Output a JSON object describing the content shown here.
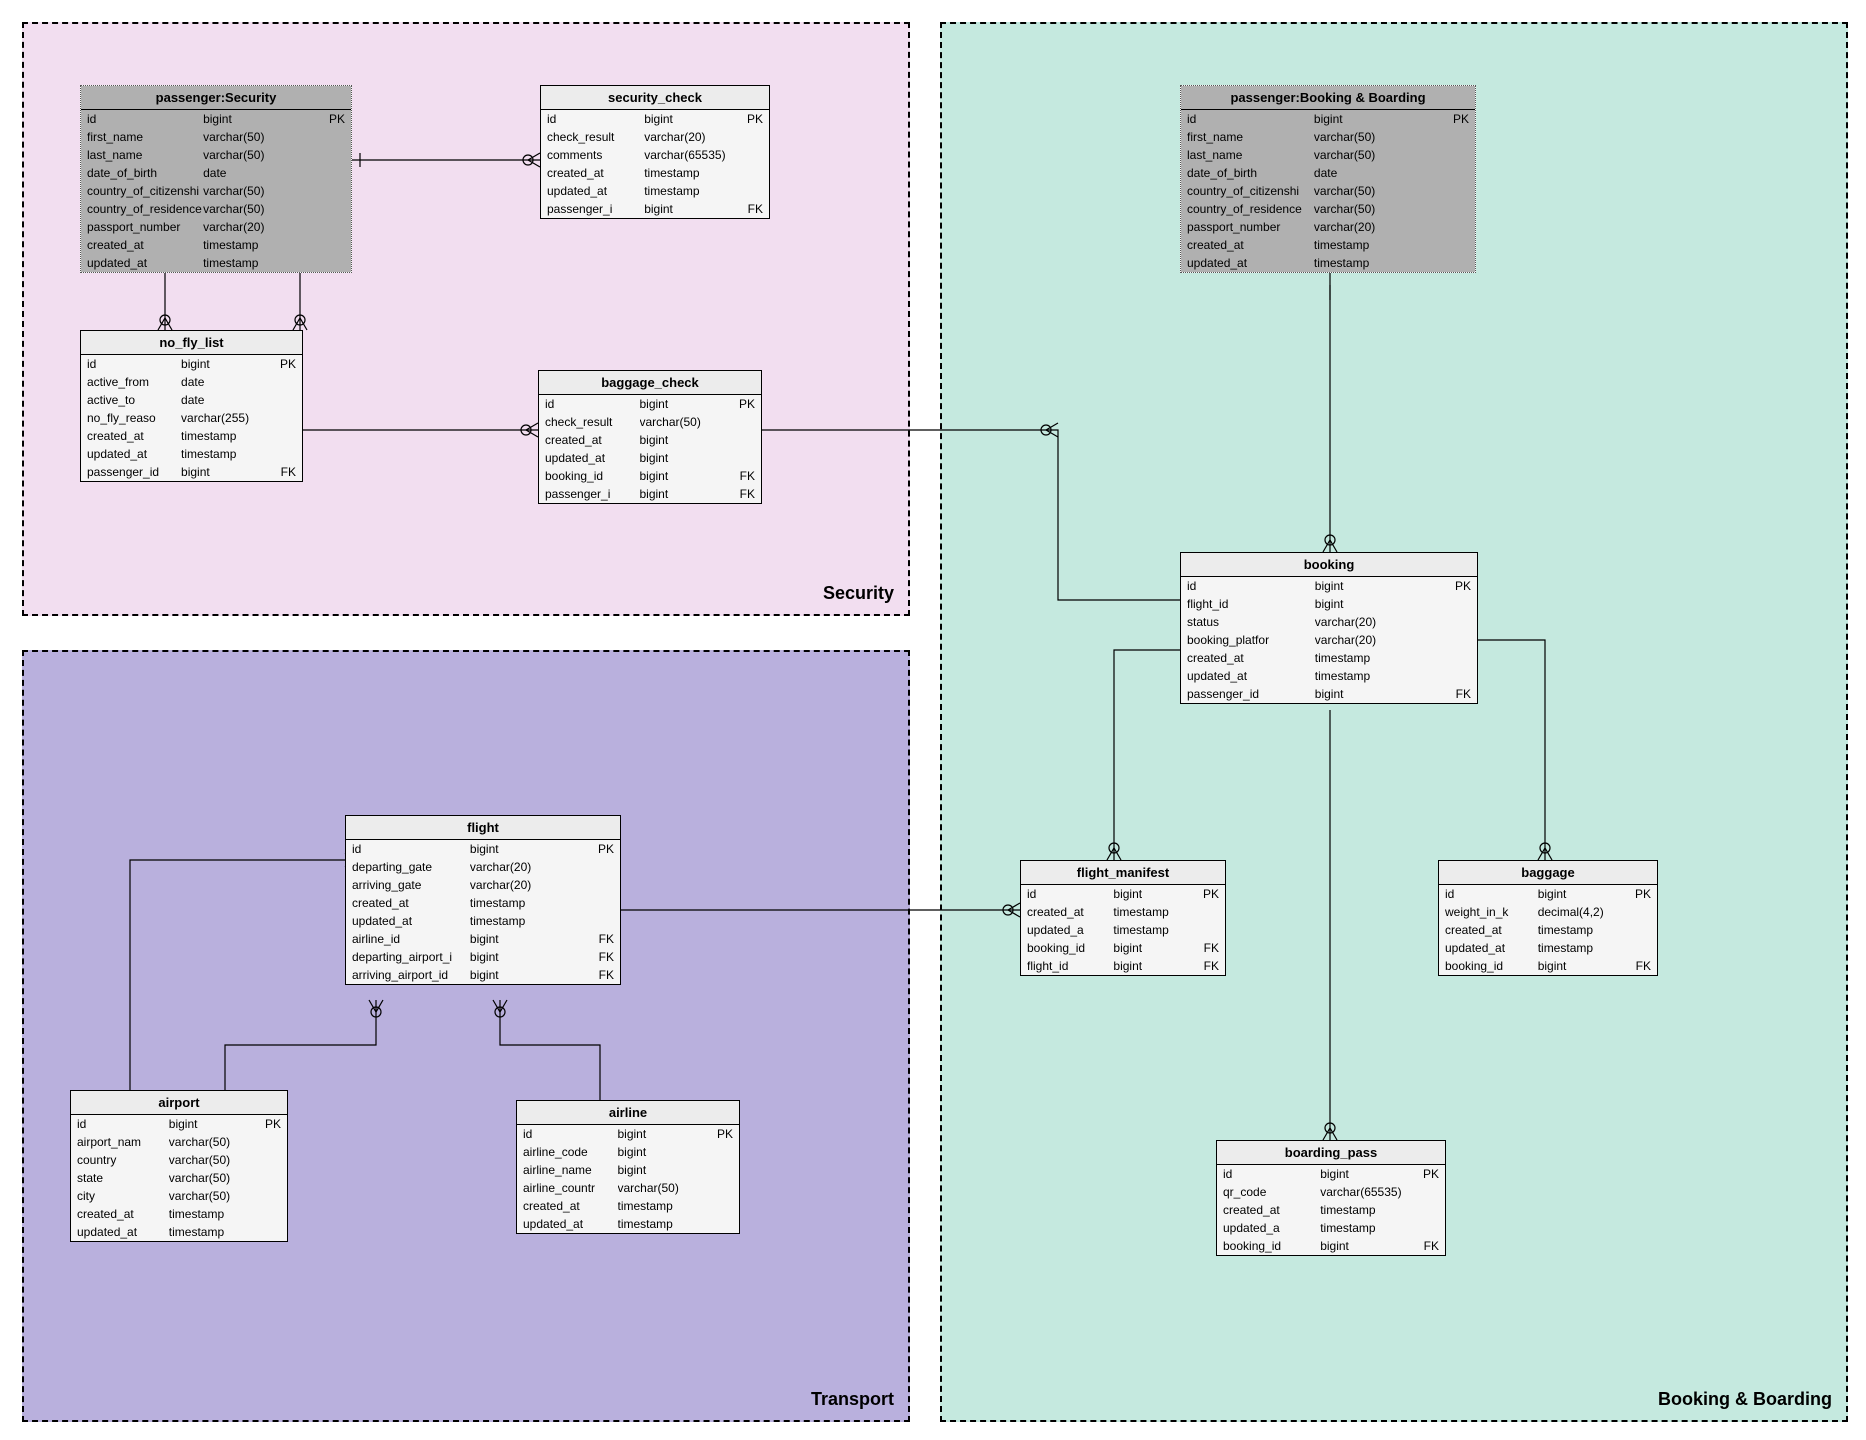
{
  "regions": {
    "security": {
      "label": "Security"
    },
    "transport": {
      "label": "Transport"
    },
    "booking": {
      "label": "Booking & Boarding"
    }
  },
  "tables": {
    "passenger_security": {
      "title": "passenger:Security",
      "rows": [
        {
          "name": "id",
          "type": "bigint",
          "key": "PK"
        },
        {
          "name": "first_name",
          "type": "varchar(50)",
          "key": ""
        },
        {
          "name": "last_name",
          "type": "varchar(50)",
          "key": ""
        },
        {
          "name": "date_of_birth",
          "type": "date",
          "key": ""
        },
        {
          "name": "country_of_citizenshi",
          "type": "varchar(50)",
          "key": ""
        },
        {
          "name": "country_of_residence",
          "type": "varchar(50)",
          "key": ""
        },
        {
          "name": "passport_number",
          "type": "varchar(20)",
          "key": ""
        },
        {
          "name": "created_at",
          "type": "timestamp",
          "key": ""
        },
        {
          "name": "updated_at",
          "type": "timestamp",
          "key": ""
        }
      ]
    },
    "security_check": {
      "title": "security_check",
      "rows": [
        {
          "name": "id",
          "type": "bigint",
          "key": "PK"
        },
        {
          "name": "check_result",
          "type": "varchar(20)",
          "key": ""
        },
        {
          "name": "comments",
          "type": "varchar(65535)",
          "key": ""
        },
        {
          "name": "created_at",
          "type": "timestamp",
          "key": ""
        },
        {
          "name": "updated_at",
          "type": "timestamp",
          "key": ""
        },
        {
          "name": "passenger_i",
          "type": "bigint",
          "key": "FK"
        }
      ]
    },
    "no_fly_list": {
      "title": "no_fly_list",
      "rows": [
        {
          "name": "id",
          "type": "bigint",
          "key": "PK"
        },
        {
          "name": "active_from",
          "type": "date",
          "key": ""
        },
        {
          "name": "active_to",
          "type": "date",
          "key": ""
        },
        {
          "name": "no_fly_reaso",
          "type": "varchar(255)",
          "key": ""
        },
        {
          "name": "created_at",
          "type": "timestamp",
          "key": ""
        },
        {
          "name": "updated_at",
          "type": "timestamp",
          "key": ""
        },
        {
          "name": "passenger_id",
          "type": "bigint",
          "key": "FK"
        }
      ]
    },
    "baggage_check": {
      "title": "baggage_check",
      "rows": [
        {
          "name": "id",
          "type": "bigint",
          "key": "PK"
        },
        {
          "name": "check_result",
          "type": "varchar(50)",
          "key": ""
        },
        {
          "name": "created_at",
          "type": "bigint",
          "key": ""
        },
        {
          "name": "updated_at",
          "type": "bigint",
          "key": ""
        },
        {
          "name": "booking_id",
          "type": "bigint",
          "key": "FK"
        },
        {
          "name": "passenger_i",
          "type": "bigint",
          "key": "FK"
        }
      ]
    },
    "flight": {
      "title": "flight",
      "rows": [
        {
          "name": "id",
          "type": "bigint",
          "key": "PK"
        },
        {
          "name": "departing_gate",
          "type": "varchar(20)",
          "key": ""
        },
        {
          "name": "arriving_gate",
          "type": "varchar(20)",
          "key": ""
        },
        {
          "name": "created_at",
          "type": "timestamp",
          "key": ""
        },
        {
          "name": "updated_at",
          "type": "timestamp",
          "key": ""
        },
        {
          "name": "airline_id",
          "type": "bigint",
          "key": "FK"
        },
        {
          "name": "departing_airport_i",
          "type": "bigint",
          "key": "FK"
        },
        {
          "name": "arriving_airport_id",
          "type": "bigint",
          "key": "FK"
        }
      ]
    },
    "airport": {
      "title": "airport",
      "rows": [
        {
          "name": "id",
          "type": "bigint",
          "key": "PK"
        },
        {
          "name": "airport_nam",
          "type": "varchar(50)",
          "key": ""
        },
        {
          "name": "country",
          "type": "varchar(50)",
          "key": ""
        },
        {
          "name": "state",
          "type": "varchar(50)",
          "key": ""
        },
        {
          "name": "city",
          "type": "varchar(50)",
          "key": ""
        },
        {
          "name": "created_at",
          "type": "timestamp",
          "key": ""
        },
        {
          "name": "updated_at",
          "type": "timestamp",
          "key": ""
        }
      ]
    },
    "airline": {
      "title": "airline",
      "rows": [
        {
          "name": "id",
          "type": "bigint",
          "key": "PK"
        },
        {
          "name": "airline_code",
          "type": "bigint",
          "key": ""
        },
        {
          "name": "airline_name",
          "type": "bigint",
          "key": ""
        },
        {
          "name": "airline_countr",
          "type": "varchar(50)",
          "key": ""
        },
        {
          "name": "created_at",
          "type": "timestamp",
          "key": ""
        },
        {
          "name": "updated_at",
          "type": "timestamp",
          "key": ""
        }
      ]
    },
    "passenger_booking": {
      "title": "passenger:Booking & Boarding",
      "rows": [
        {
          "name": "id",
          "type": "bigint",
          "key": "PK"
        },
        {
          "name": "first_name",
          "type": "varchar(50)",
          "key": ""
        },
        {
          "name": "last_name",
          "type": "varchar(50)",
          "key": ""
        },
        {
          "name": "date_of_birth",
          "type": "date",
          "key": ""
        },
        {
          "name": "country_of_citizenshi",
          "type": "varchar(50)",
          "key": ""
        },
        {
          "name": "country_of_residence",
          "type": "varchar(50)",
          "key": ""
        },
        {
          "name": "passport_number",
          "type": "varchar(20)",
          "key": ""
        },
        {
          "name": "created_at",
          "type": "timestamp",
          "key": ""
        },
        {
          "name": "updated_at",
          "type": "timestamp",
          "key": ""
        }
      ]
    },
    "booking": {
      "title": "booking",
      "rows": [
        {
          "name": "id",
          "type": "bigint",
          "key": "PK"
        },
        {
          "name": "flight_id",
          "type": "bigint",
          "key": ""
        },
        {
          "name": "status",
          "type": "varchar(20)",
          "key": ""
        },
        {
          "name": "booking_platfor",
          "type": "varchar(20)",
          "key": ""
        },
        {
          "name": "created_at",
          "type": "timestamp",
          "key": ""
        },
        {
          "name": "updated_at",
          "type": "timestamp",
          "key": ""
        },
        {
          "name": "passenger_id",
          "type": "bigint",
          "key": "FK"
        }
      ]
    },
    "flight_manifest": {
      "title": "flight_manifest",
      "rows": [
        {
          "name": "id",
          "type": "bigint",
          "key": "PK"
        },
        {
          "name": "created_at",
          "type": "timestamp",
          "key": ""
        },
        {
          "name": "updated_a",
          "type": "timestamp",
          "key": ""
        },
        {
          "name": "booking_id",
          "type": "bigint",
          "key": "FK"
        },
        {
          "name": "flight_id",
          "type": "bigint",
          "key": "FK"
        }
      ]
    },
    "baggage": {
      "title": "baggage",
      "rows": [
        {
          "name": "id",
          "type": "bigint",
          "key": "PK"
        },
        {
          "name": "weight_in_k",
          "type": "decimal(4,2)",
          "key": ""
        },
        {
          "name": "created_at",
          "type": "timestamp",
          "key": ""
        },
        {
          "name": "updated_at",
          "type": "timestamp",
          "key": ""
        },
        {
          "name": "booking_id",
          "type": "bigint",
          "key": "FK"
        }
      ]
    },
    "boarding_pass": {
      "title": "boarding_pass",
      "rows": [
        {
          "name": "id",
          "type": "bigint",
          "key": "PK"
        },
        {
          "name": "qr_code",
          "type": "varchar(65535)",
          "key": ""
        },
        {
          "name": "created_at",
          "type": "timestamp",
          "key": ""
        },
        {
          "name": "updated_a",
          "type": "timestamp",
          "key": ""
        },
        {
          "name": "booking_id",
          "type": "bigint",
          "key": "FK"
        }
      ]
    }
  }
}
